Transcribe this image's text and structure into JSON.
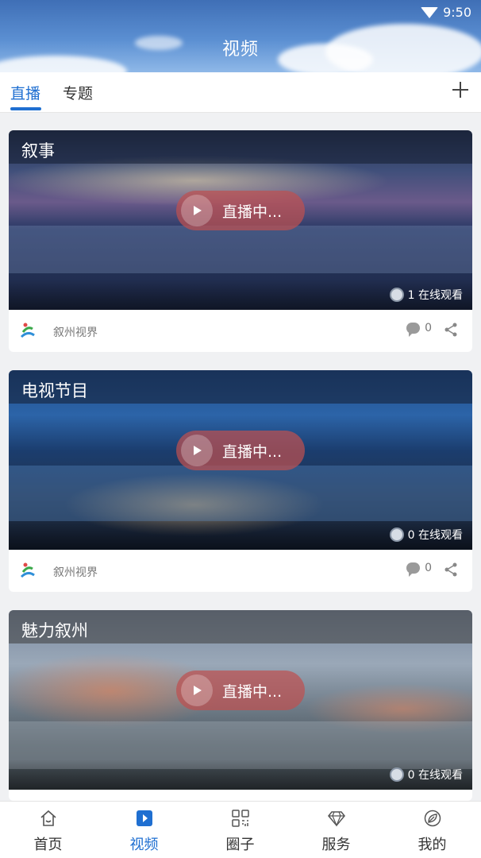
{
  "status_bar": {
    "time": "9:50"
  },
  "header": {
    "title": "视频"
  },
  "tabs": [
    {
      "label": "直播",
      "active": true
    },
    {
      "label": "专题",
      "active": false
    }
  ],
  "cards": [
    {
      "title": "叙事",
      "live_label": "直播中...",
      "viewers": "1 在线观看",
      "source": "叙州视界",
      "comments": "0"
    },
    {
      "title": "电视节目",
      "live_label": "直播中...",
      "viewers": "0 在线观看",
      "source": "叙州视界",
      "comments": "0"
    },
    {
      "title": "魅力叙州",
      "live_label": "直播中...",
      "viewers": "0 在线观看"
    }
  ],
  "bottom_nav": [
    {
      "label": "首页",
      "icon": "home-icon",
      "active": false
    },
    {
      "label": "视频",
      "icon": "video-play-icon",
      "active": true
    },
    {
      "label": "圈子",
      "icon": "qr-grid-icon",
      "active": false
    },
    {
      "label": "服务",
      "icon": "diamond-icon",
      "active": false
    },
    {
      "label": "我的",
      "icon": "profile-leaf-icon",
      "active": false
    }
  ],
  "colors": {
    "accent": "#1f6fd1",
    "live_pill": "#be5050",
    "header_top": "#3f6fb6"
  }
}
